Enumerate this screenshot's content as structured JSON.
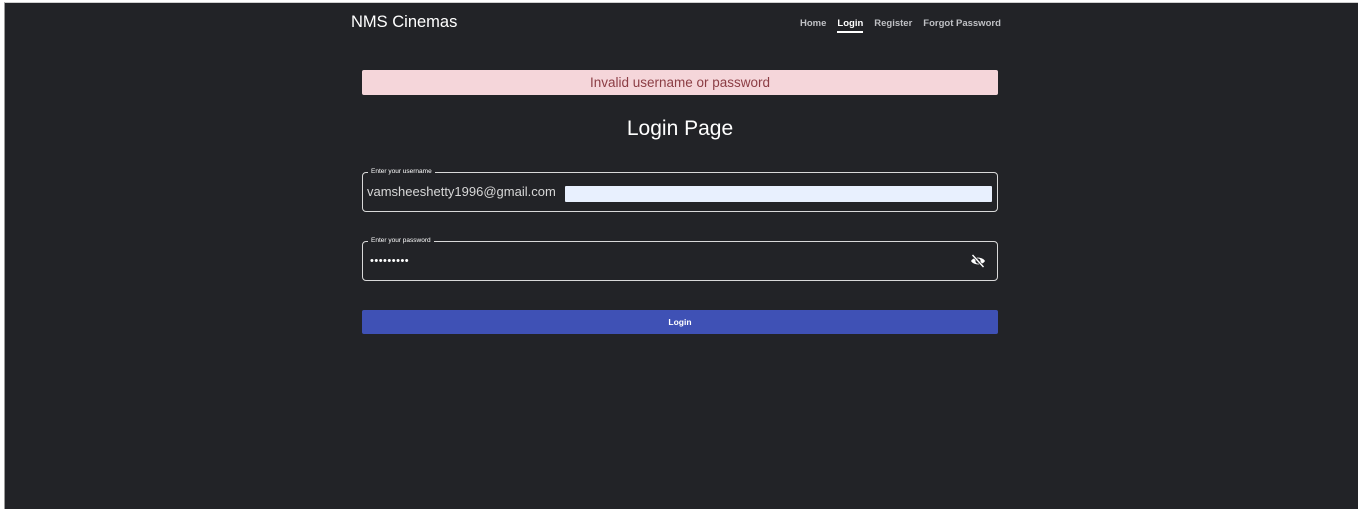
{
  "header": {
    "brand": "NMS Cinemas",
    "nav": [
      {
        "label": "Home",
        "active": false
      },
      {
        "label": "Login",
        "active": true
      },
      {
        "label": "Register",
        "active": false
      },
      {
        "label": "Forgot Password",
        "active": false
      }
    ]
  },
  "alert": {
    "message": "Invalid username or password",
    "background": "#f5d6da",
    "text_color": "#8b3d44"
  },
  "page": {
    "title": "Login Page"
  },
  "form": {
    "username": {
      "label": "Enter your username",
      "value": "vamsheeshetty1996@gmail.com"
    },
    "password": {
      "label": "Enter your password",
      "masked_value": "•••••••••",
      "toggle_icon": "eye-off-icon"
    },
    "submit_label": "Login",
    "submit_color": "#3f51b5"
  },
  "colors": {
    "background": "#222327",
    "text": "#ffffff"
  }
}
